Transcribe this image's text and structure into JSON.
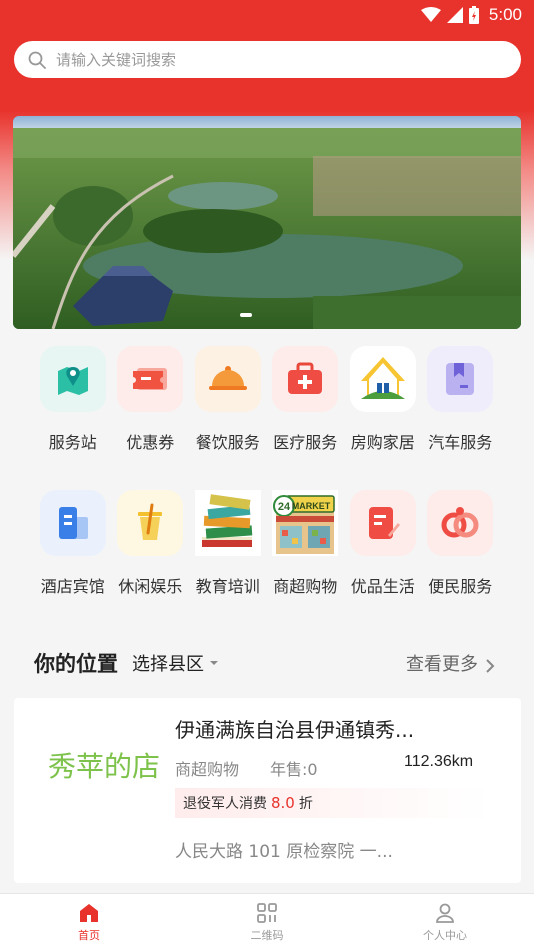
{
  "status_bar": {
    "time": "5:00"
  },
  "search": {
    "placeholder": "请输入关键词搜索"
  },
  "categories_row1": [
    {
      "label": "服务站",
      "icon": "map-pin-icon",
      "color": "#e8f6f3"
    },
    {
      "label": "优惠券",
      "icon": "ticket-icon",
      "color": "#fdecea"
    },
    {
      "label": "餐饮服务",
      "icon": "cloche-icon",
      "color": "#fdf1e4"
    },
    {
      "label": "医疗服务",
      "icon": "medical-kit-icon",
      "color": "#fdecea"
    },
    {
      "label": "房购家居",
      "icon": "house-icon",
      "color": "#ffffff"
    },
    {
      "label": "汽车服务",
      "icon": "car-service-icon",
      "color": "#efedfb"
    }
  ],
  "categories_row2": [
    {
      "label": "酒店宾馆",
      "icon": "hotel-icon",
      "color": "#eaf1fc"
    },
    {
      "label": "休闲娱乐",
      "icon": "drink-icon",
      "color": "#fef7e2"
    },
    {
      "label": "教育培训",
      "icon": "books-icon",
      "color": "#ffffff"
    },
    {
      "label": "商超购物",
      "icon": "market-icon",
      "color": "#ffffff"
    },
    {
      "label": "优品生活",
      "icon": "note-icon",
      "color": "#fdecea"
    },
    {
      "label": "便民服务",
      "icon": "rings-icon",
      "color": "#fdecea"
    }
  ],
  "market_sign": {
    "text": "MARKET",
    "hours": "24"
  },
  "location": {
    "title": "你的位置",
    "county": "选择县区",
    "see_more": "查看更多"
  },
  "shop": {
    "logo_text": "秀苹的店",
    "name": "伊通满族自治县伊通镇秀...",
    "category": "商超购物",
    "sales": "年售:0",
    "distance": "112.36km",
    "discount_prefix": "退役军人消费",
    "discount_value": "8.0",
    "discount_suffix": "折",
    "address": "人民大路 101 原检察院 一..."
  },
  "bottom_nav": [
    {
      "label": "首页",
      "icon": "home-icon",
      "active": true
    },
    {
      "label": "二维码",
      "icon": "qrcode-icon",
      "active": false
    },
    {
      "label": "个人中心",
      "icon": "user-icon",
      "active": false
    }
  ],
  "colors": {
    "brand_red": "#e8322c",
    "shop_green": "#7dc24a"
  }
}
